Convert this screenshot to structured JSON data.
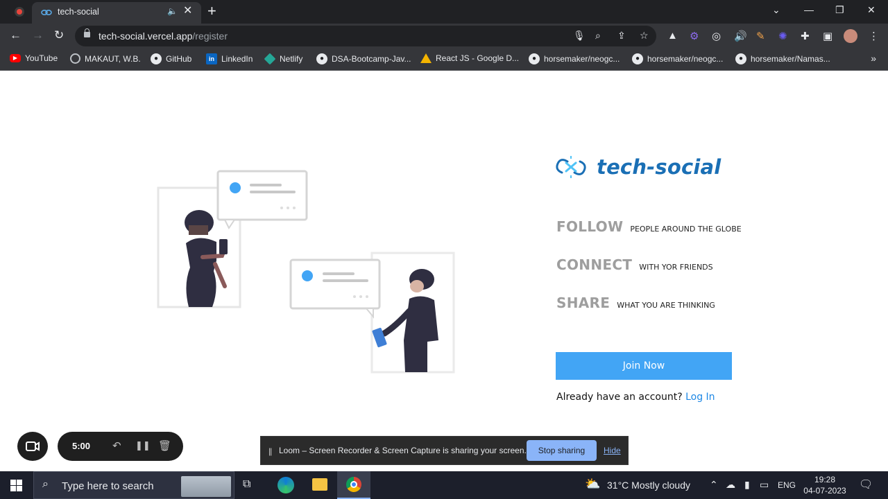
{
  "tab": {
    "title": "tech-social"
  },
  "omnibox": {
    "host": "tech-social.vercel.app",
    "path": "/register"
  },
  "bookmarks": [
    {
      "label": "YouTube",
      "icon": "youtube-icon"
    },
    {
      "label": "MAKAUT, W.B.",
      "icon": "globe-icon"
    },
    {
      "label": "GitHub",
      "icon": "github-icon"
    },
    {
      "label": "LinkedIn",
      "icon": "linkedin-icon"
    },
    {
      "label": "Netlify",
      "icon": "netlify-icon"
    },
    {
      "label": "DSA-Bootcamp-Jav...",
      "icon": "github-icon"
    },
    {
      "label": "React JS - Google D...",
      "icon": "google-drive-icon"
    },
    {
      "label": "horsemaker/neogc...",
      "icon": "github-icon"
    },
    {
      "label": "horsemaker/neogc...",
      "icon": "github-icon"
    },
    {
      "label": "horsemaker/Namas...",
      "icon": "github-icon"
    }
  ],
  "brand": {
    "name": "tech-social",
    "color": "#1a6fb5"
  },
  "features": [
    {
      "word": "FOLLOW",
      "sub": "PEOPLE AROUND THE GLOBE"
    },
    {
      "word": "CONNECT",
      "sub": "WITH YOR FRIENDS"
    },
    {
      "word": "SHARE",
      "sub": "WHAT YOU ARE THINKING"
    }
  ],
  "cta": {
    "join": "Join Now",
    "account_prompt": "Already have an account?",
    "login": "Log In"
  },
  "loom": {
    "timer": "5:00",
    "share_message": "Loom – Screen Recorder & Screen Capture is sharing your screen.",
    "stop": "Stop sharing",
    "hide": "Hide"
  },
  "taskbar": {
    "search_placeholder": "Type here to search",
    "weather": "31°C  Mostly cloudy",
    "lang": "ENG",
    "time": "19:28",
    "date": "04-07-2023"
  },
  "colors": {
    "accent": "#42a5f5",
    "link": "#1e88e5",
    "chrome_dark": "#202124"
  }
}
